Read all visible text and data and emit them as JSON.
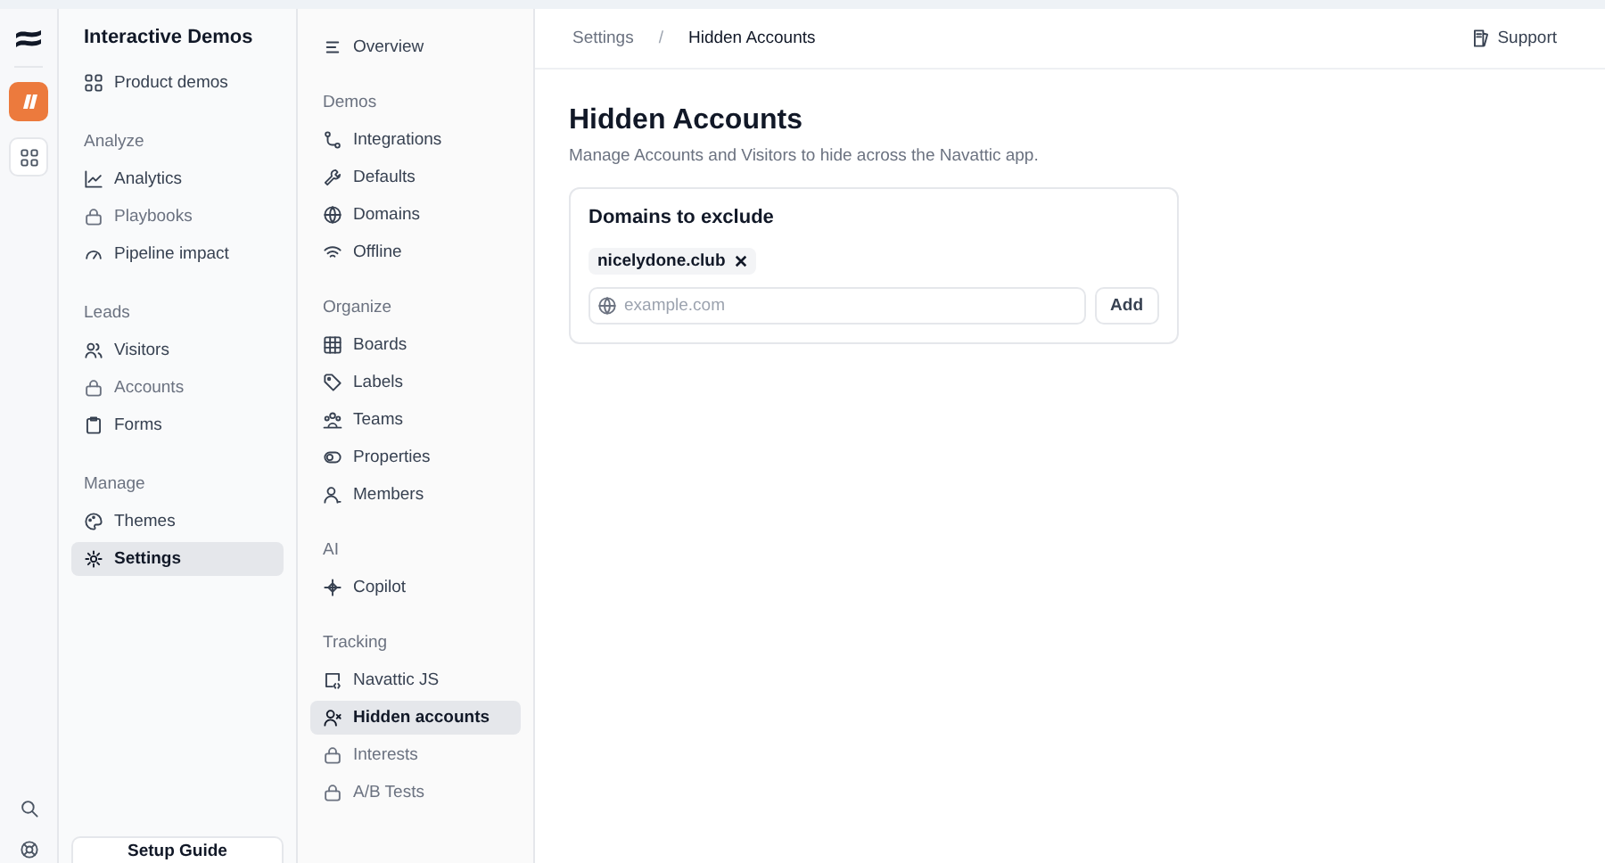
{
  "sidebar": {
    "title": "Interactive Demos",
    "items": [
      {
        "label": "Product demos",
        "selected": false,
        "locked": false
      }
    ],
    "sections": [
      {
        "heading": "Analyze",
        "items": [
          {
            "label": "Analytics",
            "selected": false,
            "locked": false
          },
          {
            "label": "Playbooks",
            "selected": false,
            "locked": true
          },
          {
            "label": "Pipeline impact",
            "selected": false,
            "locked": false
          }
        ]
      },
      {
        "heading": "Leads",
        "items": [
          {
            "label": "Visitors",
            "selected": false,
            "locked": false
          },
          {
            "label": "Accounts",
            "selected": false,
            "locked": true
          },
          {
            "label": "Forms",
            "selected": false,
            "locked": false
          }
        ]
      },
      {
        "heading": "Manage",
        "items": [
          {
            "label": "Themes",
            "selected": false,
            "locked": false
          },
          {
            "label": "Settings",
            "selected": true,
            "locked": false
          }
        ]
      }
    ],
    "setup_button": "Setup Guide"
  },
  "subnav": {
    "items": [
      {
        "label": "Overview",
        "selected": false,
        "locked": false
      }
    ],
    "sections": [
      {
        "heading": "Demos",
        "items": [
          {
            "label": "Integrations",
            "selected": false,
            "locked": false
          },
          {
            "label": "Defaults",
            "selected": false,
            "locked": false
          },
          {
            "label": "Domains",
            "selected": false,
            "locked": false
          },
          {
            "label": "Offline",
            "selected": false,
            "locked": false
          }
        ]
      },
      {
        "heading": "Organize",
        "items": [
          {
            "label": "Boards",
            "selected": false,
            "locked": false
          },
          {
            "label": "Labels",
            "selected": false,
            "locked": false
          },
          {
            "label": "Teams",
            "selected": false,
            "locked": false
          },
          {
            "label": "Properties",
            "selected": false,
            "locked": false
          },
          {
            "label": "Members",
            "selected": false,
            "locked": false
          }
        ]
      },
      {
        "heading": "AI",
        "items": [
          {
            "label": "Copilot",
            "selected": false,
            "locked": false
          }
        ]
      },
      {
        "heading": "Tracking",
        "items": [
          {
            "label": "Navattic JS",
            "selected": false,
            "locked": false
          },
          {
            "label": "Hidden accounts",
            "selected": true,
            "locked": false
          },
          {
            "label": "Interests",
            "selected": false,
            "locked": true
          },
          {
            "label": "A/B Tests",
            "selected": false,
            "locked": true
          }
        ]
      }
    ]
  },
  "breadcrumb": [
    "Settings",
    "Hidden Accounts"
  ],
  "breadcrumb_separator": "/",
  "support_link": "Support",
  "page": {
    "title": "Hidden Accounts",
    "description": "Manage Accounts and Visitors to hide across the Navattic app."
  },
  "card": {
    "title": "Domains to exclude",
    "tags": [
      {
        "label": "nicelydone.club"
      }
    ],
    "input": {
      "placeholder": "example.com"
    },
    "button": "Add"
  }
}
